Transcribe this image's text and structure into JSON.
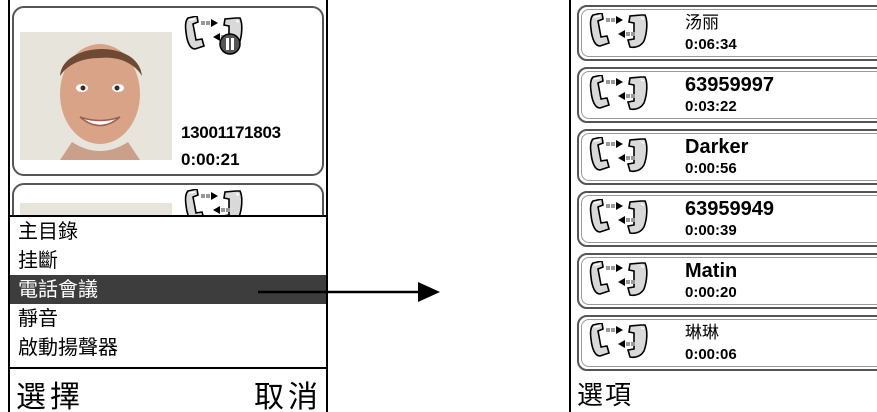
{
  "left_screen": {
    "active_call": {
      "number": "13001171803",
      "duration": "0:00:21"
    },
    "menu": {
      "items": [
        {
          "label": "主目錄"
        },
        {
          "label": "挂斷"
        },
        {
          "label": "電話會議",
          "selected": true
        },
        {
          "label": "靜音"
        },
        {
          "label": "啟動揚聲器"
        }
      ]
    },
    "softkeys": {
      "select": "選擇",
      "cancel": "取消"
    }
  },
  "right_screen": {
    "calls": [
      {
        "name": "汤丽",
        "duration": "0:06:34"
      },
      {
        "name": "63959997",
        "duration": "0:03:22"
      },
      {
        "name": "Darker",
        "duration": "0:00:56"
      },
      {
        "name": "63959949",
        "duration": "0:00:39"
      },
      {
        "name": "Matin",
        "duration": "0:00:20"
      },
      {
        "name": "琳琳",
        "duration": "0:00:06"
      }
    ],
    "softkey": "選項"
  },
  "icons": {
    "call_icon": "two-phones-call-icon",
    "hold_icon": "call-on-hold-icon",
    "arrow": "right-arrow-icon"
  },
  "colors": {
    "selected_bg": "#3d3d3d",
    "card_border": "#555555"
  }
}
